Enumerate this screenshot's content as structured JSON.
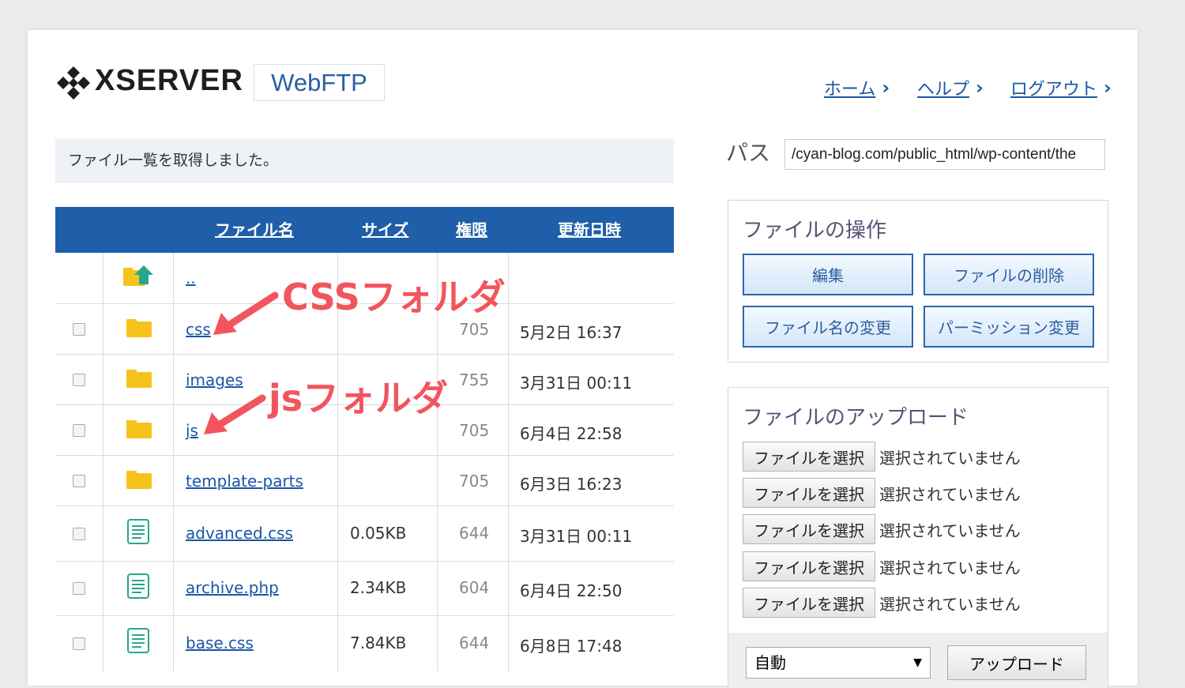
{
  "header": {
    "brand": "XSERVER",
    "badge": "WebFTP",
    "nav": [
      {
        "label": "ホーム"
      },
      {
        "label": "ヘルプ"
      },
      {
        "label": "ログアウト"
      }
    ],
    "chevron": "›"
  },
  "message": "ファイル一覧を取得しました。",
  "table": {
    "columns": {
      "name": "ファイル名",
      "size": "サイズ",
      "perm": "権限",
      "date": "更新日時"
    },
    "parent": "..",
    "rows": [
      {
        "name": "css",
        "size": "",
        "perm": "705",
        "date": "5月2日 16:37",
        "type": "folder"
      },
      {
        "name": "images",
        "size": "",
        "perm": "755",
        "date": "3月31日 00:11",
        "type": "folder"
      },
      {
        "name": "js",
        "size": "",
        "perm": "705",
        "date": "6月4日 22:58",
        "type": "folder"
      },
      {
        "name": "template-parts",
        "size": "",
        "perm": "705",
        "date": "6月3日 16:23",
        "type": "folder"
      },
      {
        "name": "advanced.css",
        "size": "0.05KB",
        "perm": "644",
        "date": "3月31日 00:11",
        "type": "file"
      },
      {
        "name": "archive.php",
        "size": "2.34KB",
        "perm": "604",
        "date": "6月4日 22:50",
        "type": "file"
      },
      {
        "name": "base.css",
        "size": "7.84KB",
        "perm": "644",
        "date": "6月8日 17:48",
        "type": "file"
      }
    ]
  },
  "annotations": {
    "css": "CSSフォルダ",
    "js": "jsフォルダ",
    "color": "#f2555d"
  },
  "path": {
    "label": "パス",
    "value": "/cyan-blog.com/public_html/wp-content/the"
  },
  "file_ops": {
    "title": "ファイルの操作",
    "buttons": [
      "編集",
      "ファイルの削除",
      "ファイル名の変更",
      "パーミッション変更"
    ]
  },
  "upload": {
    "title": "ファイルのアップロード",
    "choose_label": "ファイルを選択",
    "none_label": "選択されていません",
    "mode": "自動",
    "submit": "アップロード"
  },
  "colors": {
    "header_blue": "#1f5ea8",
    "link": "#1a57a6",
    "folder": "#f6c21c",
    "file": "#27a68e"
  }
}
